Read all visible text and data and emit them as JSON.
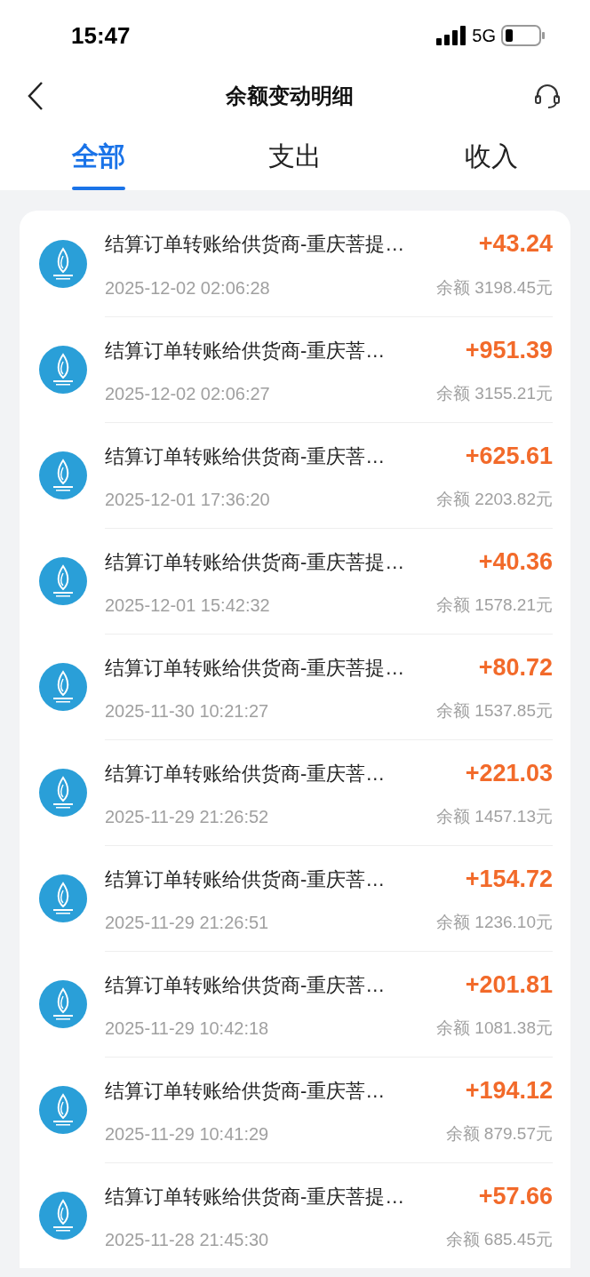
{
  "status_bar": {
    "time": "15:47",
    "network": "5G"
  },
  "header": {
    "title": "余额变动明细"
  },
  "tabs": [
    {
      "label": "全部",
      "selected": true
    },
    {
      "label": "支出",
      "selected": false
    },
    {
      "label": "收入",
      "selected": false
    }
  ],
  "transactions": [
    {
      "title": "结算订单转账给供货商-重庆菩提…",
      "time": "2025-12-02 02:06:28",
      "amount": "+43.24",
      "balance": "余额 3198.45元"
    },
    {
      "title": "结算订单转账给供货商-重庆菩…",
      "time": "2025-12-02 02:06:27",
      "amount": "+951.39",
      "balance": "余额 3155.21元"
    },
    {
      "title": "结算订单转账给供货商-重庆菩…",
      "time": "2025-12-01 17:36:20",
      "amount": "+625.61",
      "balance": "余额 2203.82元"
    },
    {
      "title": "结算订单转账给供货商-重庆菩提…",
      "time": "2025-12-01 15:42:32",
      "amount": "+40.36",
      "balance": "余额 1578.21元"
    },
    {
      "title": "结算订单转账给供货商-重庆菩提…",
      "time": "2025-11-30 10:21:27",
      "amount": "+80.72",
      "balance": "余额 1537.85元"
    },
    {
      "title": "结算订单转账给供货商-重庆菩…",
      "time": "2025-11-29 21:26:52",
      "amount": "+221.03",
      "balance": "余额 1457.13元"
    },
    {
      "title": "结算订单转账给供货商-重庆菩…",
      "time": "2025-11-29 21:26:51",
      "amount": "+154.72",
      "balance": "余额 1236.10元"
    },
    {
      "title": "结算订单转账给供货商-重庆菩…",
      "time": "2025-11-29 10:42:18",
      "amount": "+201.81",
      "balance": "余额 1081.38元"
    },
    {
      "title": "结算订单转账给供货商-重庆菩…",
      "time": "2025-11-29 10:41:29",
      "amount": "+194.12",
      "balance": "余额 879.57元"
    },
    {
      "title": "结算订单转账给供货商-重庆菩提…",
      "time": "2025-11-28 21:45:30",
      "amount": "+57.66",
      "balance": "余额 685.45元"
    }
  ]
}
